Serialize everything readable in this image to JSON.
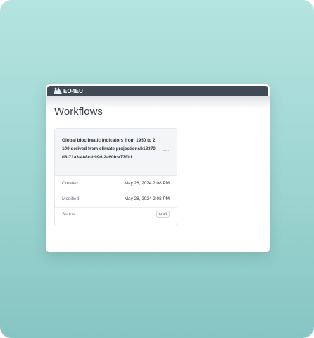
{
  "app": {
    "logo_text": "EO4EU"
  },
  "page": {
    "title": "Workflows"
  },
  "workflow_card": {
    "title": "Global bioclimatic indicators from 1950 to 2100 derived from climate projectionsb18370d8-71a3-488c-b99d-2a60fca77f0d",
    "more_icon": "more-horizontal-icon",
    "more_glyph": "···",
    "rows": [
      {
        "label": "Created",
        "value": "May 28, 2024 2:08 PM"
      },
      {
        "label": "Modified",
        "value": "May 28, 2024 2:08 PM"
      },
      {
        "label": "Status",
        "value": "draft"
      }
    ]
  },
  "colors": {
    "topbar": "#3f4a56",
    "background_top": "#b5e4e0",
    "background_bottom": "#86c5c3"
  }
}
